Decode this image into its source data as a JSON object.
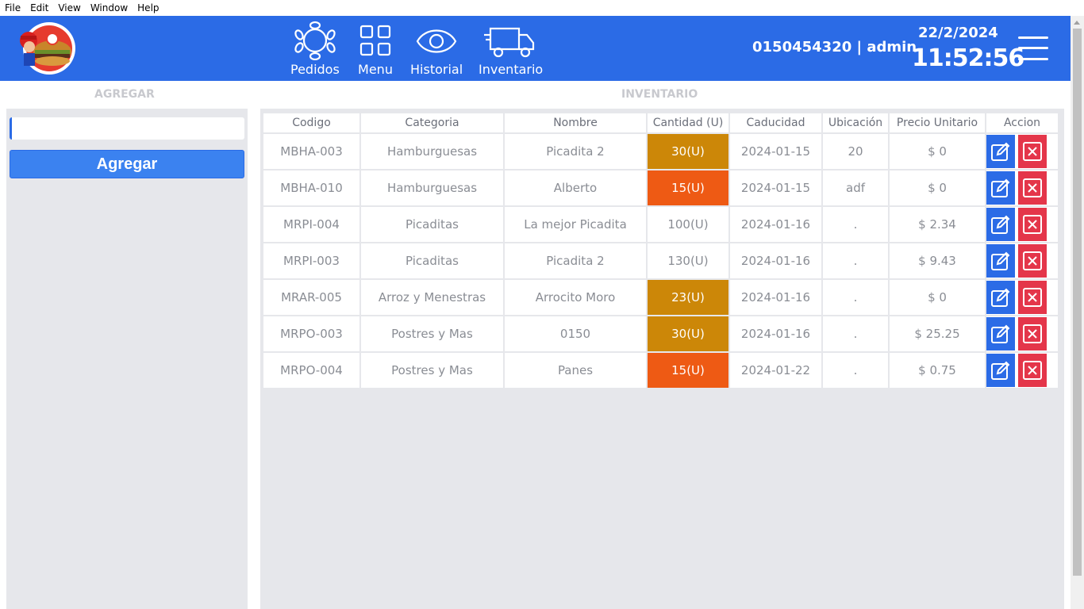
{
  "menubar": {
    "items": [
      "File",
      "Edit",
      "View",
      "Window",
      "Help"
    ]
  },
  "header": {
    "nav": [
      {
        "label": "Pedidos",
        "icon": "table-setting-icon"
      },
      {
        "label": "Menu",
        "icon": "grid-icon"
      },
      {
        "label": "Historial",
        "icon": "eye-icon"
      },
      {
        "label": "Inventario",
        "icon": "truck-icon"
      }
    ],
    "user_info": "0150454320 | admin",
    "date": "22/2/2024",
    "time": "11:52:56"
  },
  "agregar": {
    "title": "AGREGAR",
    "input_value": "",
    "button_label": "Agregar"
  },
  "inventario": {
    "title": "INVENTARIO",
    "columns": [
      "Codigo",
      "Categoria",
      "Nombre",
      "Cantidad (U)",
      "Caducidad",
      "Ubicación",
      "Precio Unitario",
      "Accion"
    ],
    "rows": [
      {
        "codigo": "MBHA-003",
        "categoria": "Hamburguesas",
        "nombre": "Picadita 2",
        "cantidad": "30(U)",
        "nivel": "warn",
        "caducidad": "2024-01-15",
        "ubicacion": "20",
        "precio": "$ 0"
      },
      {
        "codigo": "MBHA-010",
        "categoria": "Hamburguesas",
        "nombre": "Alberto",
        "cantidad": "15(U)",
        "nivel": "low",
        "caducidad": "2024-01-15",
        "ubicacion": "adf",
        "precio": "$ 0"
      },
      {
        "codigo": "MRPI-004",
        "categoria": "Picaditas",
        "nombre": "La mejor Picadita",
        "cantidad": "100(U)",
        "nivel": "ok",
        "caducidad": "2024-01-16",
        "ubicacion": ".",
        "precio": "$ 2.34"
      },
      {
        "codigo": "MRPI-003",
        "categoria": "Picaditas",
        "nombre": "Picadita 2",
        "cantidad": "130(U)",
        "nivel": "ok",
        "caducidad": "2024-01-16",
        "ubicacion": ".",
        "precio": "$ 9.43"
      },
      {
        "codigo": "MRAR-005",
        "categoria": "Arroz y Menestras",
        "nombre": "Arrocito Moro",
        "cantidad": "23(U)",
        "nivel": "warn",
        "caducidad": "2024-01-16",
        "ubicacion": ".",
        "precio": "$ 0"
      },
      {
        "codigo": "MRPO-003",
        "categoria": "Postres y Mas",
        "nombre": "0150",
        "cantidad": "30(U)",
        "nivel": "warn",
        "caducidad": "2024-01-16",
        "ubicacion": ".",
        "precio": "$ 25.25"
      },
      {
        "codigo": "MRPO-004",
        "categoria": "Postres y Mas",
        "nombre": "Panes",
        "cantidad": "15(U)",
        "nivel": "low",
        "caducidad": "2024-01-22",
        "ubicacion": ".",
        "precio": "$ 0.75"
      }
    ]
  },
  "colors": {
    "header_bg": "#2b6be6",
    "panel_bg": "#e6e7eb",
    "qty_warn": "#cc8708",
    "qty_low": "#ee5a14",
    "edit_button": "#2b6be6",
    "delete_button": "#e4364a"
  }
}
